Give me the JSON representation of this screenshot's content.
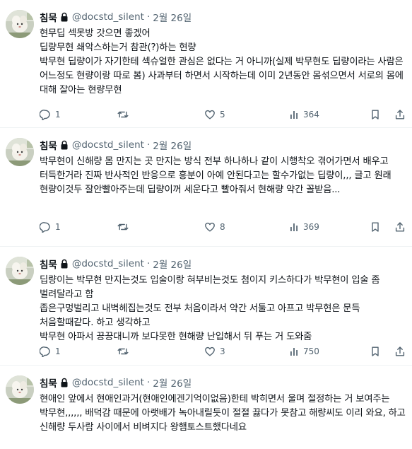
{
  "author": {
    "name": "침묵",
    "handle": "@docstd_silent",
    "separator": "·"
  },
  "tweets": [
    {
      "date": "2월 26일",
      "text": "현무딥 섹못방 갓으면 좋겠어\n딥량무현 쇄악스하는거 참관(?)하는 현량\n박무현 딥량이가 자기한테 섹슈얼한 관심은 없다는 거 아니까(실제 박무현도 딥량이라는 사람은 어느정도 현량이랑 따로 봄) 사과부터 하면서 시작하는데 이미 2년동안 몸섞으면서 서로의 몸에 대해 잘아는 현량무현",
      "replies": "1",
      "retweets": "",
      "likes": "5",
      "views": "364"
    },
    {
      "date": "2월 26일",
      "text": "박무현이 신해량 몸 만지는 곳 만지는 방식 전부 하나하나 같이 시행착오 겪어가면서 배우고 터득한거라 진짜 반사적인 반응으로 흥분이 아예 안된다고는 할수가없는 딥량이,,, 글고 원래 현량이것두 잘안빨아주는데 딥량이꺼 세운다고 빨아줘서 현해량 약간 꼴받음...",
      "replies": "1",
      "retweets": "",
      "likes": "8",
      "views": "369"
    },
    {
      "date": "2월 26일",
      "text": "딥량이는 박무현 만지는것도 입술이랑 혀부비는것도 첨이지 키스하다가 박무현이 입술 좀 벌려달라고 함\n좁은구멍벌리고 내벽헤집는것도 전부 처음이라서 약간 서툴고 아프고 박무현은 문득 처음할때같다. 하고 생각하고\n박무현 아파서 끙끙대니까 보다못한 현해량 난입해서 뒤 푸는 거 도와줌",
      "replies": "1",
      "retweets": "",
      "likes": "3",
      "views": "750"
    },
    {
      "date": "2월 26일",
      "text": "현애인 앞에서 현애인과거(현애인에겐기억이없음)한테 박히면서 울며 절정하는 거 보여주는 박무현,,,,,, 배덕감 때문에 아랫배가 녹아내릴듯이 절절 끓다가 못참고 해량씨도 이리 와요, 하고 신해량 두사람 사이에서 비벼지다 왕햄토스트했다네요"
    }
  ],
  "icons": {
    "lock": "lock-icon",
    "reply": "reply-icon",
    "retweet": "retweet-icon",
    "like": "heart-icon",
    "views": "views-icon",
    "bookmark": "bookmark-icon",
    "share": "share-icon"
  },
  "colors": {
    "text": "#0f1419",
    "secondary": "#536471",
    "divider": "#eff3f4"
  }
}
